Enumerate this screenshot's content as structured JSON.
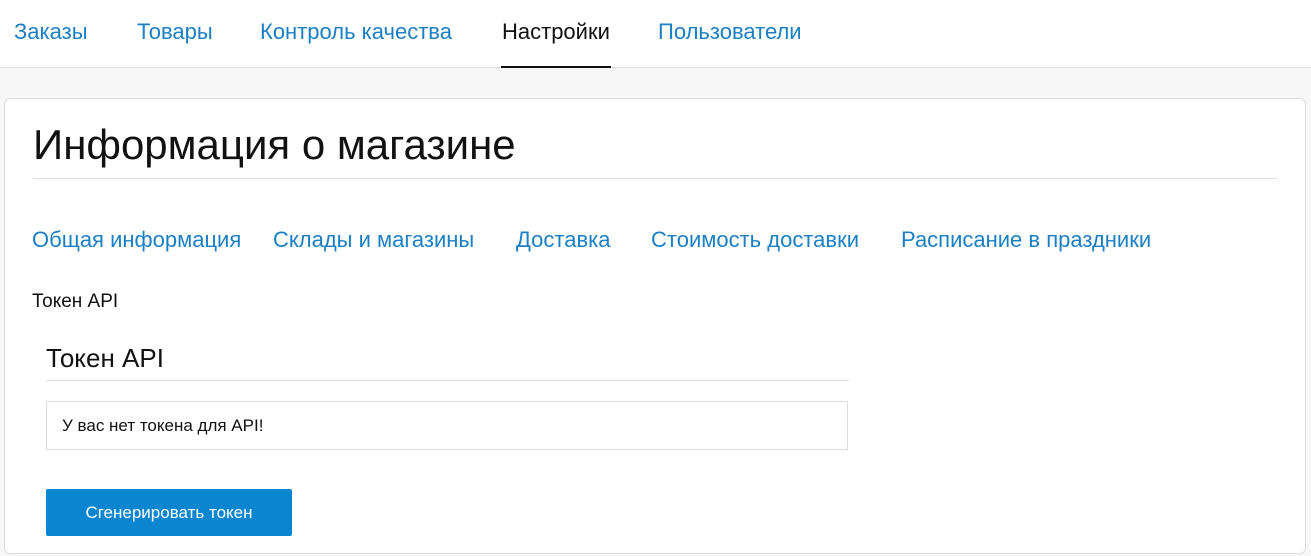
{
  "top_nav": {
    "tabs": [
      {
        "label": "Заказы",
        "active": false
      },
      {
        "label": "Товары",
        "active": false
      },
      {
        "label": "Контроль качества",
        "active": false
      },
      {
        "label": "Настройки",
        "active": true
      },
      {
        "label": "Пользователи",
        "active": false
      }
    ]
  },
  "page": {
    "title": "Информация о магазине"
  },
  "sub_nav": {
    "tabs": [
      {
        "label": "Общая информация"
      },
      {
        "label": "Склады и магазины"
      },
      {
        "label": "Доставка"
      },
      {
        "label": "Стоимость доставки"
      },
      {
        "label": "Расписание в праздники"
      }
    ]
  },
  "api_token": {
    "section_label": "Токен API",
    "panel_title": "Токен API",
    "message": "У вас нет токена для API!",
    "generate_button_label": "Сгенерировать токен"
  },
  "colors": {
    "link": "#1a7fc4",
    "primary_button": "#0a86d1",
    "active_tab": "#111111"
  }
}
